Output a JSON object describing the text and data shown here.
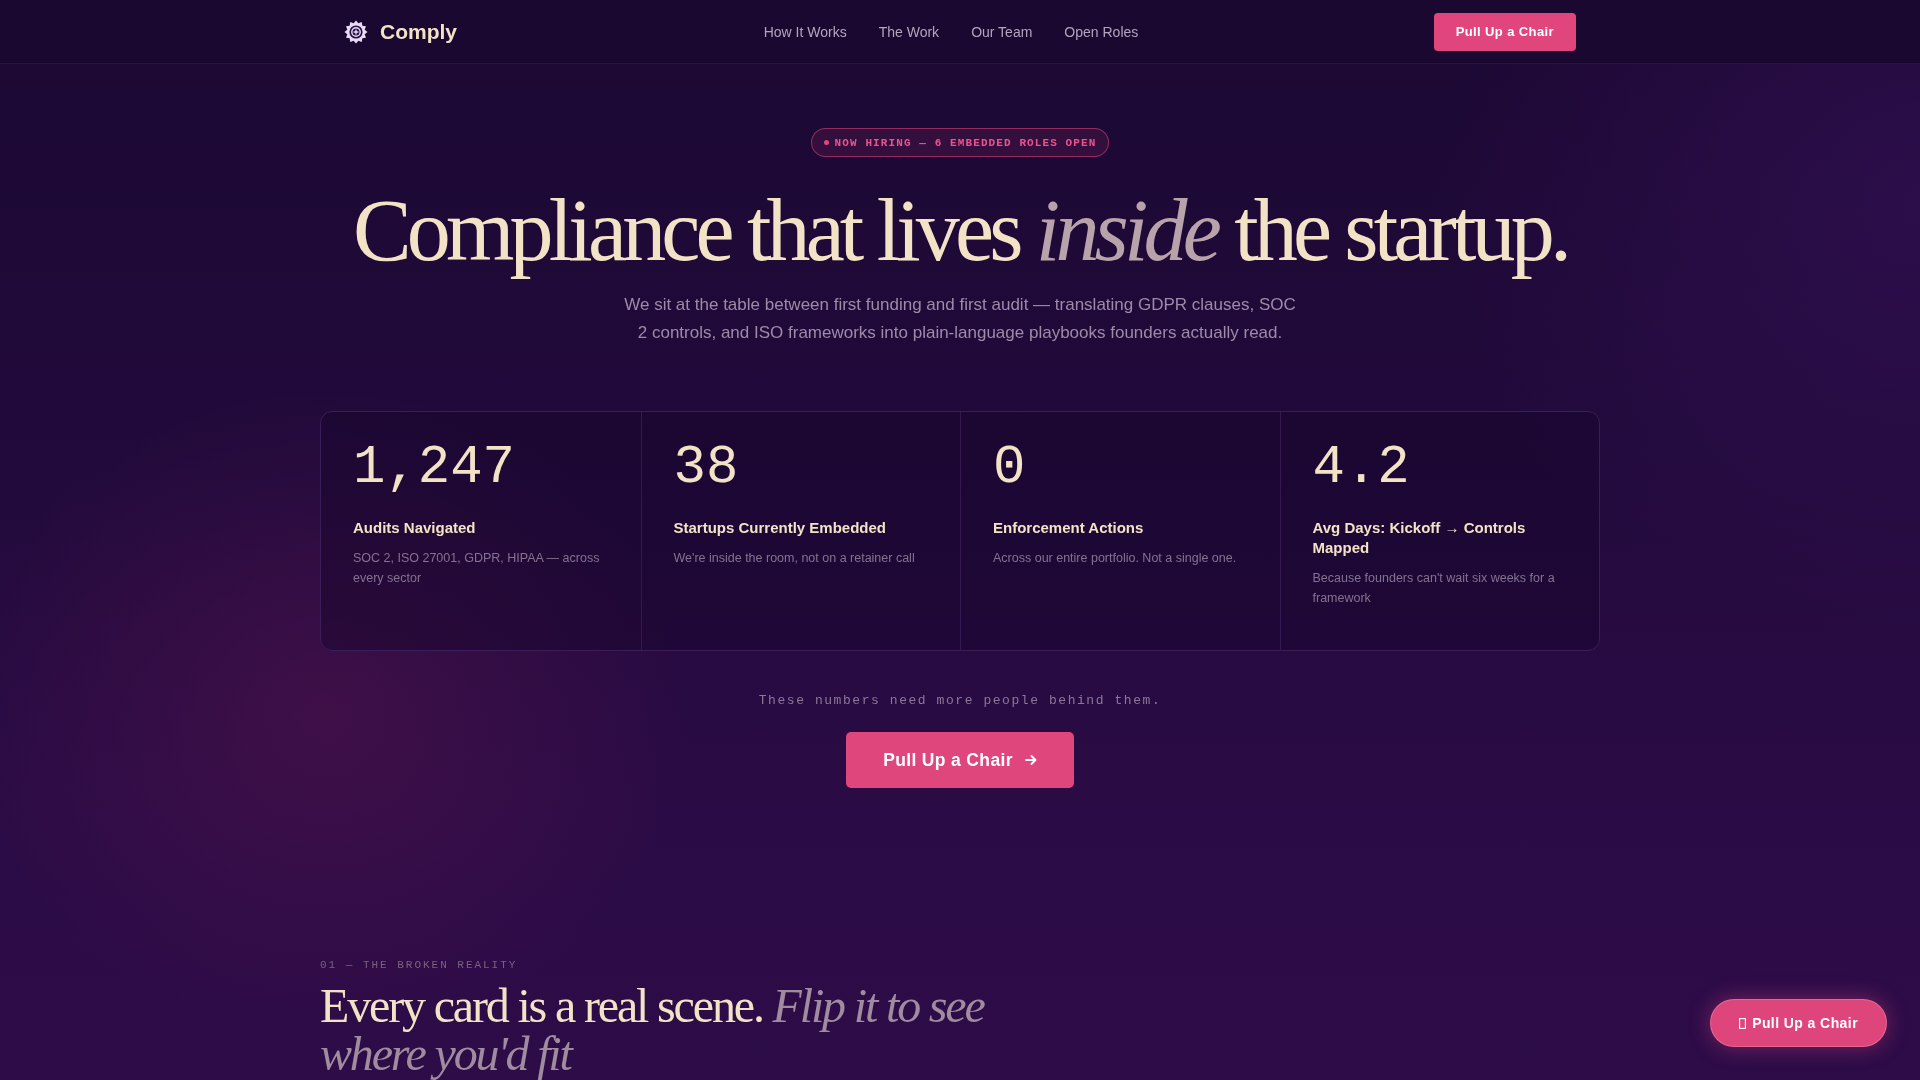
{
  "nav": {
    "brand": "Comply",
    "links": [
      {
        "label": "How It Works"
      },
      {
        "label": "The Work"
      },
      {
        "label": "Our Team"
      },
      {
        "label": "Open Roles"
      }
    ],
    "cta": "Pull Up a Chair"
  },
  "hero": {
    "badge": "NOW HIRING — 6 EMBEDDED ROLES OPEN",
    "headline": "Compliance that lives *inside* the startup.",
    "subtitle": "We sit at the table between first funding and first audit — translating GDPR clauses, SOC 2 controls, and ISO frameworks into plain-language playbooks founders actually read."
  },
  "stats": [
    {
      "value": "1,247",
      "label": "Audits Navigated",
      "description": "SOC 2, ISO 27001, GDPR, HIPAA — across every sector"
    },
    {
      "value": "38",
      "label": "Startups Currently Embedded",
      "description": "We're inside the room, not on a retainer call"
    },
    {
      "value": "0",
      "label": "Enforcement Actions",
      "description": "Across our entire portfolio. Not a single one."
    },
    {
      "value": "4.2",
      "label": "Avg Days: Kickoff → Controls Mapped",
      "description": "Because founders can't wait six weeks for a framework"
    }
  ],
  "cta_section": {
    "note": "These numbers need more people behind them.",
    "button": "Pull Up a Chair"
  },
  "section": {
    "eyebrow": "01 — THE BROKEN REALITY",
    "heading": "Every card is a real scene. *Flip it to see where you'd fit*"
  },
  "floating_button": {
    "label": "Pull Up a Chair"
  }
}
